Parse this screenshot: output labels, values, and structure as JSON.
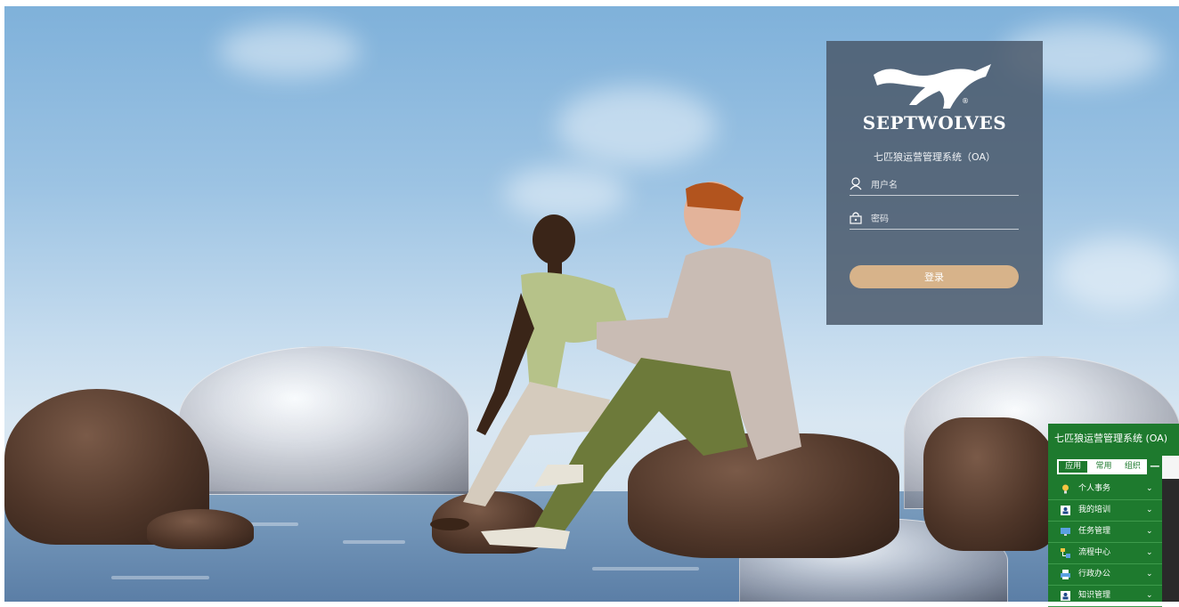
{
  "login": {
    "brand": "SEPTWOLVES",
    "registered_mark": "®",
    "system_title": "七匹狼运营管理系统（OA）",
    "username_placeholder": "用户名",
    "password_placeholder": "密码",
    "login_button": "登录"
  },
  "widget": {
    "title": "七匹狼运营管理系统 (OA)",
    "tabs": [
      {
        "label": "应用",
        "active": true
      },
      {
        "label": "常用",
        "active": false
      },
      {
        "label": "组织",
        "active": false
      }
    ],
    "collapse_symbol": "−",
    "menu": [
      {
        "label": "个人事务",
        "icon": "lightbulb-icon"
      },
      {
        "label": "我的培训",
        "icon": "person-card-icon"
      },
      {
        "label": "任务管理",
        "icon": "monitor-icon"
      },
      {
        "label": "流程中心",
        "icon": "flow-icon"
      },
      {
        "label": "行政办公",
        "icon": "printer-icon"
      },
      {
        "label": "知识管理",
        "icon": "person-card-icon"
      }
    ]
  },
  "colors": {
    "card_bg": "#485667",
    "login_button": "#d7b38a",
    "widget_green": "#1e7a2e"
  }
}
